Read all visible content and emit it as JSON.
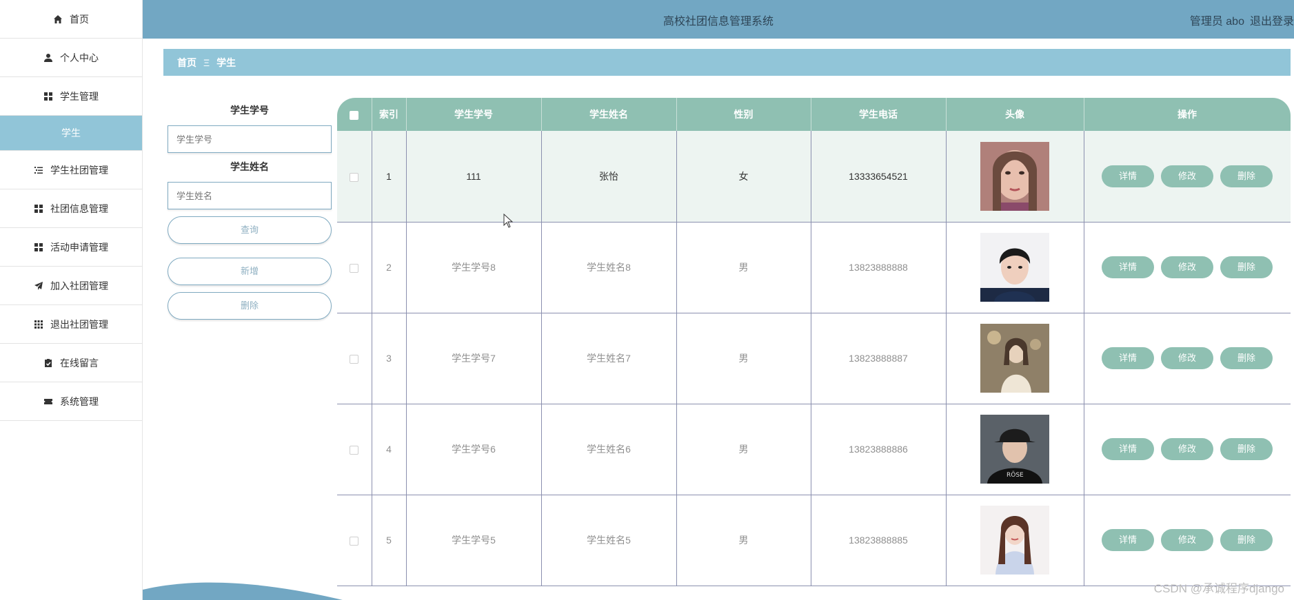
{
  "header": {
    "title": "高校社团信息管理系统",
    "user_label": "管理员 abo",
    "logout_label": "退出登录"
  },
  "sidebar": {
    "items": [
      {
        "label": "首页",
        "icon": "home-icon"
      },
      {
        "label": "个人中心",
        "icon": "user-icon"
      },
      {
        "label": "学生管理",
        "icon": "grid-icon"
      },
      {
        "label": "学生",
        "icon": "",
        "active": true
      },
      {
        "label": "学生社团管理",
        "icon": "list-icon"
      },
      {
        "label": "社团信息管理",
        "icon": "grid-icon"
      },
      {
        "label": "活动申请管理",
        "icon": "grid-icon"
      },
      {
        "label": "加入社团管理",
        "icon": "paper-plane-icon"
      },
      {
        "label": "退出社团管理",
        "icon": "apps-icon"
      },
      {
        "label": "在线留言",
        "icon": "clipboard-icon"
      },
      {
        "label": "系统管理",
        "icon": "ticket-icon"
      }
    ]
  },
  "breadcrumb": {
    "home": "首页",
    "sep": "Ξ",
    "current": "学生"
  },
  "search": {
    "id_label": "学生学号",
    "id_placeholder": "学生学号",
    "name_label": "学生姓名",
    "name_placeholder": "学生姓名",
    "query_button": "查询",
    "add_button": "新增",
    "delete_button": "删除"
  },
  "table": {
    "headers": [
      "索引",
      "学生学号",
      "学生姓名",
      "性别",
      "学生电话",
      "头像",
      "操作"
    ],
    "actions": [
      "详情",
      "修改",
      "删除"
    ],
    "rows": [
      {
        "index": "1",
        "student_id": "111",
        "name": "张怡",
        "gender": "女",
        "phone": "13333654521"
      },
      {
        "index": "2",
        "student_id": "学生学号8",
        "name": "学生姓名8",
        "gender": "男",
        "phone": "13823888888"
      },
      {
        "index": "3",
        "student_id": "学生学号7",
        "name": "学生姓名7",
        "gender": "男",
        "phone": "13823888887"
      },
      {
        "index": "4",
        "student_id": "学生学号6",
        "name": "学生姓名6",
        "gender": "男",
        "phone": "13823888886"
      },
      {
        "index": "5",
        "student_id": "学生学号5",
        "name": "学生姓名5",
        "gender": "男",
        "phone": "13823888885"
      }
    ]
  },
  "watermark": "CSDN @承诚程序django",
  "colors": {
    "header_bg": "#72a7c3",
    "breadcrumb_bg": "#91c5d8",
    "table_header_bg": "#8fc0b2",
    "action_button_bg": "#8fc0b2"
  }
}
